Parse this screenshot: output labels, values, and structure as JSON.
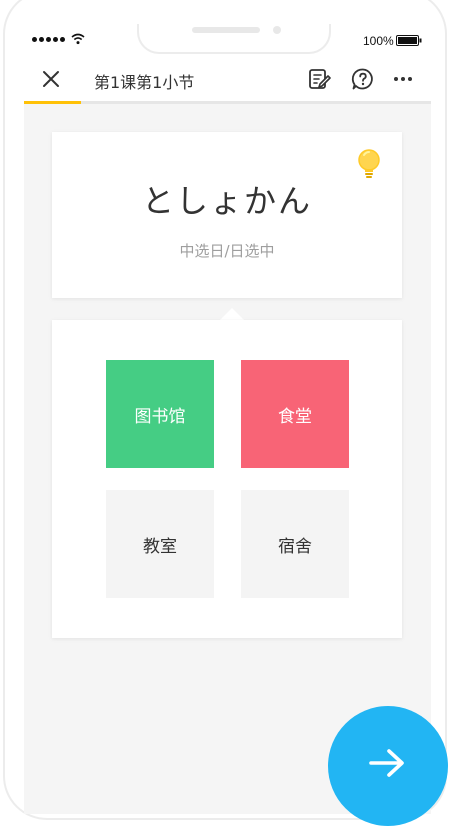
{
  "status_bar": {
    "battery": "100%"
  },
  "header": {
    "title": "第1课第1小节",
    "progress": 0.14
  },
  "word_card": {
    "word": "としょかん",
    "hint": "中选日/日选中"
  },
  "options": [
    {
      "label": "图书馆",
      "state": "correct"
    },
    {
      "label": "食堂",
      "state": "wrong"
    },
    {
      "label": "教室",
      "state": "neutral"
    },
    {
      "label": "宿舍",
      "state": "neutral"
    }
  ],
  "colors": {
    "accent_progress": "#ffc107",
    "correct": "#45cd84",
    "wrong": "#f86476",
    "next_button": "#22b5f3"
  },
  "icons": {
    "close": "close-icon",
    "note": "note-edit-icon",
    "help": "question-icon",
    "more": "more-icon",
    "hint": "lightbulb-icon",
    "next": "arrow-right-icon"
  }
}
